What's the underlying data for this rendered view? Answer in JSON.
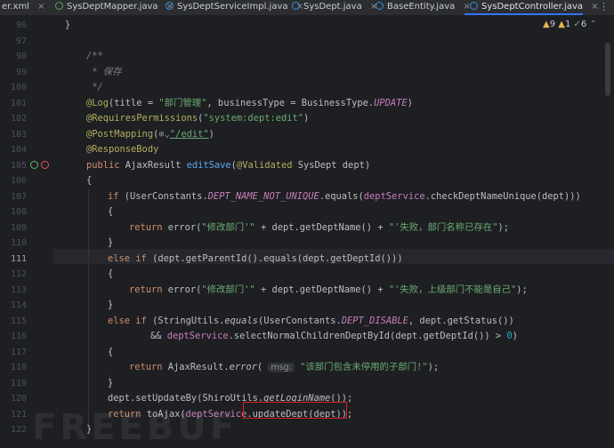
{
  "tabs": [
    {
      "label": "er.xml",
      "icon": "xml-file-icon",
      "active": false
    },
    {
      "label": "SysDeptMapper.java",
      "icon": "interface-icon",
      "active": false
    },
    {
      "label": "SysDeptServiceImpl.java",
      "icon": "class-icon",
      "active": false
    },
    {
      "label": "SysDept.java",
      "icon": "class-icon",
      "active": false
    },
    {
      "label": "BaseEntity.java",
      "icon": "class-icon",
      "active": false
    },
    {
      "label": "SysDeptController.java",
      "icon": "class-icon",
      "active": true
    }
  ],
  "tab_close_glyph": "×",
  "tab_more_glyph": "⋮",
  "inspections": {
    "warnings": "9",
    "weak_warnings": "1",
    "ok": "6"
  },
  "current_line": "111",
  "line_numbers": [
    "96",
    "97",
    "98",
    "99",
    "100",
    "101",
    "102",
    "103",
    "104",
    "105",
    "106",
    "107",
    "108",
    "109",
    "110",
    "111",
    "112",
    "113",
    "114",
    "115",
    "116",
    "117",
    "118",
    "119",
    "120",
    "121",
    "122"
  ],
  "code": {
    "l96_brace": "}",
    "l98_open": "/**",
    "l99_text": " * 保存",
    "l100_close": " */",
    "l101_ann": "@Log",
    "l101_p1": "(title = ",
    "l101_s1": "\"部门管理\"",
    "l101_p2": ", businessType = BusinessType.",
    "l101_const": "UPDATE",
    "l101_p3": ")",
    "l102_ann": "@RequiresPermissions",
    "l102_p1": "(",
    "l102_s1": "\"system:dept:edit\"",
    "l102_p2": ")",
    "l103_ann": "@PostMapping",
    "l103_p1": "(",
    "l103_globe": "⊕⌄",
    "l103_s1": "\"/edit\"",
    "l103_p2": ")",
    "l104_ann": "@ResponseBody",
    "l105_kw": "public ",
    "l105_t": "AjaxResult ",
    "l105_fn": "editSave",
    "l105_p1": "(",
    "l105_ann": "@Validated",
    "l105_p2": " SysDept dept)",
    "l106_brace": "{",
    "l107_kw": "if ",
    "l107_p1": "(UserConstants.",
    "l107_const": "DEPT_NAME_NOT_UNIQUE",
    "l107_p2": ".equals(",
    "l107_fld": "deptService",
    "l107_p3": ".checkDeptNameUnique(dept)))",
    "l108_brace": "{",
    "l109_kw": "return ",
    "l109_p1": "error(",
    "l109_s1": "\"修改部门'\"",
    "l109_p2": " + dept.getDeptName() + ",
    "l109_s2": "\"'失败，部门名称已存在\"",
    "l109_p3": ");",
    "l110_brace": "}",
    "l111_kw1": "else ",
    "l111_kw2": "if ",
    "l111_p1": "(dept.getParentId().equals(dept.getDeptId()))",
    "l112_brace": "{",
    "l113_kw": "return ",
    "l113_p1": "error(",
    "l113_s1": "\"修改部门'\"",
    "l113_p2": " + dept.getDeptName() + ",
    "l113_s2": "\"'失败，上级部门不能是自己\"",
    "l113_p3": ");",
    "l114_brace": "}",
    "l115_kw1": "else ",
    "l115_kw2": "if ",
    "l115_p1": "(StringUtils.",
    "l115_fn": "equals",
    "l115_p2": "(UserConstants.",
    "l115_const": "DEPT_DISABLE",
    "l115_p3": ", dept.getStatus())",
    "l116_p1": "&& ",
    "l116_fld": "deptService",
    "l116_p2": ".selectNormalChildrenDeptById(dept.getDeptId()) > ",
    "l116_num": "0",
    "l116_p3": ")",
    "l117_brace": "{",
    "l118_kw": "return ",
    "l118_p1": "AjaxResult.",
    "l118_fn": "error",
    "l118_p2": "( ",
    "l118_hint": "msg:",
    "l118_s1": " \"该部门包含未停用的子部门!\"",
    "l118_p3": ");",
    "l119_brace": "}",
    "l120_p1": "dept.setUpdateBy(ShiroUtils.",
    "l120_fn": "getLoginName",
    "l120_p2": "());",
    "l121_kw": "return ",
    "l121_p1": "toAjax(",
    "l121_fld": "deptService",
    "l121_p2": ".updateDept(dept));",
    "l122_brace": "}"
  },
  "watermark": "FREEBUF"
}
